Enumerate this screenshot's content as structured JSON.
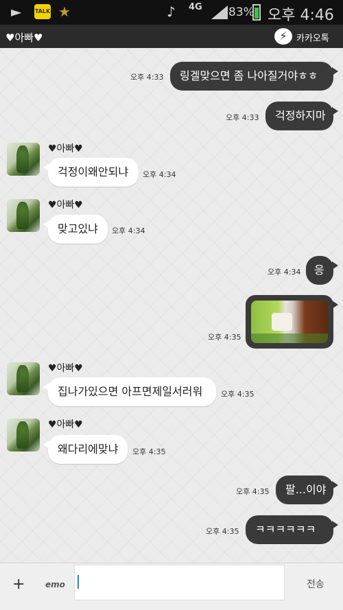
{
  "status_bar": {
    "talk_label": "TALK",
    "network": "4G",
    "battery": "83%",
    "time": "오후 4:46"
  },
  "header": {
    "title": "♥아빠♥",
    "brand": "카카오톡"
  },
  "messages": [
    {
      "dir": "out",
      "text": "링겔맞으면 좀 나아질거야ㅎㅎ",
      "time": "오후 4:33"
    },
    {
      "dir": "out",
      "text": "걱정하지마",
      "time": "오후 4:33"
    },
    {
      "dir": "in",
      "sender": "♥아빠♥",
      "text": "걱정이왜안되냐",
      "time": "오후 4:34"
    },
    {
      "dir": "in",
      "sender": "♥아빠♥",
      "text": "맞고있냐",
      "time": "오후 4:34"
    },
    {
      "dir": "out",
      "text": "응",
      "time": "오후 4:34"
    },
    {
      "dir": "out",
      "photo": true,
      "time": "오후 4:35"
    },
    {
      "dir": "in",
      "sender": "♥아빠♥",
      "text": "집나가있으면 아프면제일서러워",
      "time": "오후 4:35"
    },
    {
      "dir": "in",
      "sender": "♥아빠♥",
      "text": "왜다리에맞냐",
      "time": "오후 4:35"
    },
    {
      "dir": "out",
      "text": "팔...이야",
      "time": "오후 4:35"
    },
    {
      "dir": "out",
      "text": "ㅋㅋㅋㅋㅋㅋ",
      "time": "오후 4:35"
    }
  ],
  "input_bar": {
    "plus": "+",
    "emo": "emo",
    "send": "전송"
  },
  "colors": {
    "outgoing_bubble": "#3a3a3a",
    "incoming_bubble": "#ffffff",
    "header": "#2b2b2b"
  }
}
